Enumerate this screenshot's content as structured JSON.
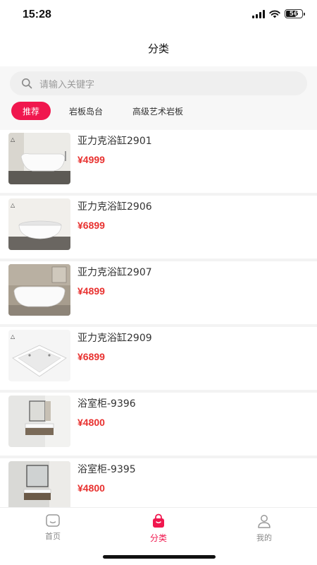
{
  "status_bar": {
    "time": "15:28",
    "battery": "56"
  },
  "header": {
    "title": "分类"
  },
  "search": {
    "placeholder": "请输入关键字"
  },
  "categories": [
    {
      "label": "推荐",
      "active": true
    },
    {
      "label": "岩板岛台",
      "active": false
    },
    {
      "label": "高级艺术岩板",
      "active": false
    }
  ],
  "products": [
    {
      "name": "亚力克浴缸2901",
      "price": "¥4999"
    },
    {
      "name": "亚力克浴缸2906",
      "price": "¥6899"
    },
    {
      "name": "亚力克浴缸2907",
      "price": "¥4899"
    },
    {
      "name": "亚力克浴缸2909",
      "price": "¥6899"
    },
    {
      "name": "浴室柜-9396",
      "price": "¥4800"
    },
    {
      "name": "浴室柜-9395",
      "price": "¥4800"
    }
  ],
  "tab_bar": {
    "items": [
      {
        "label": "首页",
        "icon": "home-icon"
      },
      {
        "label": "分类",
        "icon": "bag-icon",
        "active": true
      },
      {
        "label": "我的",
        "icon": "user-icon"
      }
    ]
  },
  "colors": {
    "accent": "#f0174e",
    "price": "#e8312f"
  }
}
